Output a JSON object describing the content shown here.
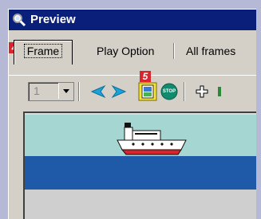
{
  "window": {
    "title": "Preview",
    "title_icon": "magnifier-icon"
  },
  "tabs": [
    {
      "label": "Frame",
      "badge": "4",
      "selected": true
    },
    {
      "label": "Play Option"
    },
    {
      "label": "All frames"
    }
  ],
  "toolbar": {
    "frame_select_value": "1",
    "buttons": [
      {
        "icon": "previous-arrow-icon"
      },
      {
        "icon": "next-arrow-icon"
      },
      {
        "icon": "play-preview-icon",
        "badge": "5"
      },
      {
        "icon": "stop-icon",
        "text": "STOP"
      },
      {
        "icon": "zoom-in-icon"
      }
    ]
  },
  "colors": {
    "titlebar": "#0a1f7a",
    "badge": "#d9232d",
    "sky": "#a5d6d1",
    "sea": "#1e5aa8",
    "arrow": "#19a3d9",
    "stop": "#128a6e"
  }
}
